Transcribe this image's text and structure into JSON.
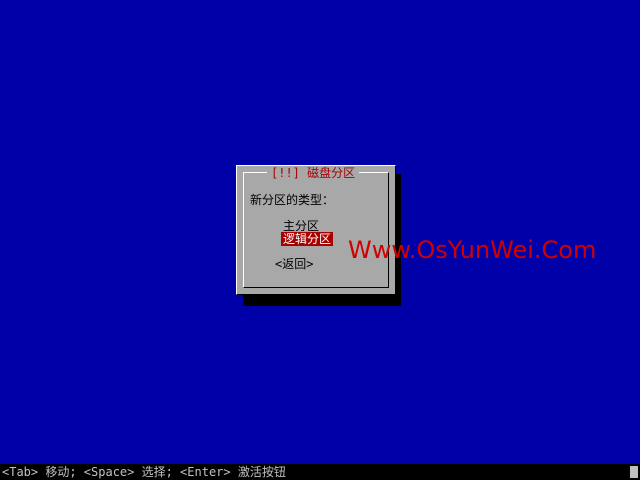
{
  "colors": {
    "background": "#0000a8",
    "dialog": "#a8a8a8",
    "title": "#a80000",
    "selected_bg": "#a80000",
    "watermark": "#d00000"
  },
  "dialog": {
    "title": "[!!] 磁盘分区",
    "prompt": "新分区的类型：",
    "options": [
      "主分区",
      "逻辑分区"
    ],
    "selected_option": "逻辑分区",
    "back_button": "<返回>"
  },
  "watermark": "Www.OsYunWei.Com",
  "statusbar": {
    "text": "<Tab> 移动; <Space> 选择; <Enter> 激活按钮"
  }
}
